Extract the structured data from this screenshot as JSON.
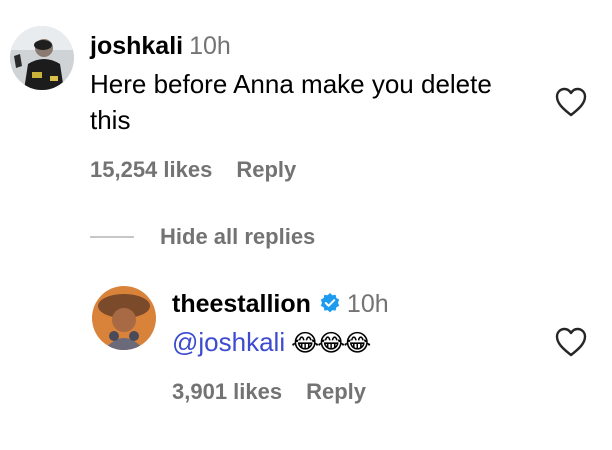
{
  "comment": {
    "username": "joshkali",
    "time": "10h",
    "text_line1": "Here before Anna make you delete",
    "text_line2": "this",
    "likes": "15,254 likes",
    "reply_label": "Reply"
  },
  "replies_toggle": "Hide all replies",
  "reply": {
    "username": "theestallion",
    "time": "10h",
    "mention": "@joshkali",
    "emojis": "😂😂😂",
    "likes": "3,901 likes",
    "reply_label": "Reply"
  },
  "colors": {
    "meta": "#737373",
    "mention": "#3d4bcf",
    "verified": "#1d9bf0"
  },
  "icons": [
    "heart-icon",
    "verified-badge-icon"
  ]
}
